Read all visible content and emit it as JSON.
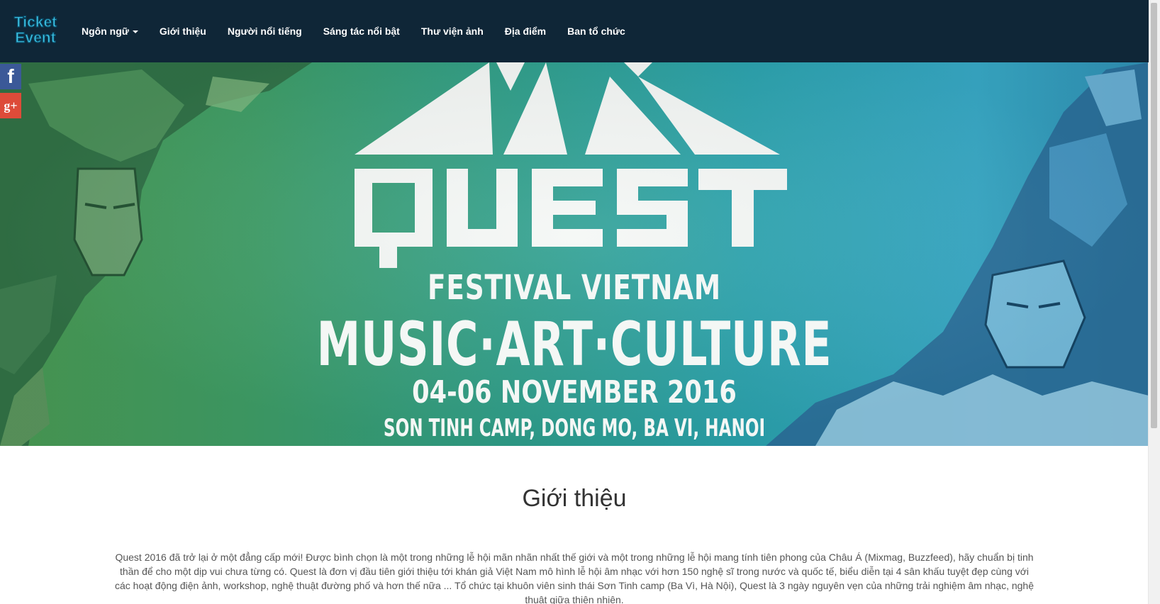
{
  "brand": {
    "logo_line1": "Ticket",
    "logo_line2": "Event"
  },
  "nav": {
    "items": [
      {
        "label": "Ngôn ngữ",
        "dropdown": true
      },
      {
        "label": "Giới thiệu"
      },
      {
        "label": "Người nổi tiếng"
      },
      {
        "label": "Sáng tác nổi bật"
      },
      {
        "label": "Thư viện ảnh"
      },
      {
        "label": "Địa điểm"
      },
      {
        "label": "Ban tổ chức"
      }
    ]
  },
  "social": {
    "facebook_glyph": "f",
    "googleplus_glyph": "g+"
  },
  "hero": {
    "logo_word": "QUEST",
    "subtitle": "FESTIVAL VIETNAM",
    "tagline": "MUSIC·ART·CULTURE",
    "dates": "04-06 NOVEMBER 2016",
    "venue": "SON TINH CAMP, DONG MO, BA VI, HANOI"
  },
  "intro": {
    "title": "Giới thiệu",
    "body": "Quest 2016 đã trở lại ở một đẳng cấp mới! Được bình chọn là một trong những lễ hội mãn nhãn nhất thế giới và một trong những lễ hội mang tính tiên phong của Châu Á (Mixmag, Buzzfeed), hãy chuẩn bị tinh thần để cho một dịp vui chưa từng có. Quest là đơn vị đầu tiên giới thiệu tới khán giả Việt Nam mô hình lễ hội âm nhạc với hơn 150 nghệ sĩ trong nước và quốc tế, biểu diễn tại 4 sân khấu tuyệt đẹp cùng với các hoạt động điện ảnh, workshop, nghệ thuật đường phố và hơn thế nữa ... Tổ chức tại khuôn viên sinh thái Sơn Tinh camp (Ba Vì, Hà Nội), Quest là 3 ngày nguyên vẹn của những trải nghiệm âm nhạc, nghệ thuật giữa thiên nhiên."
  },
  "colors": {
    "navbar": "#0f2637",
    "facebook": "#3b5998",
    "googleplus": "#dd4b39",
    "logo_fill": "#3fc7e8"
  }
}
